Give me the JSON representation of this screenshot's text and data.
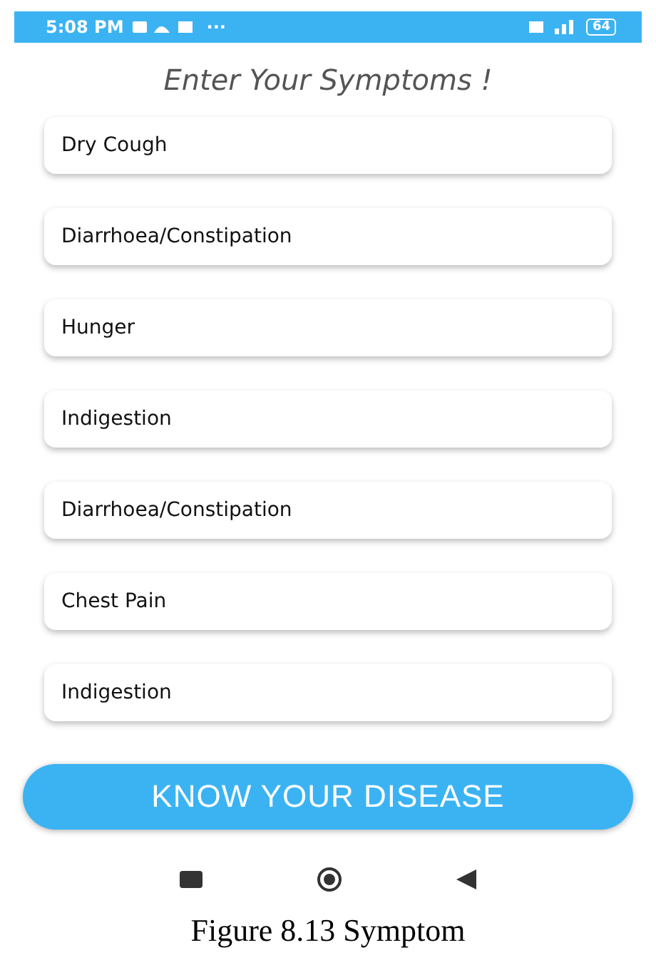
{
  "status_bar": {
    "time": "5:08 PM",
    "more": "···",
    "battery": "64"
  },
  "title": "Enter Your Symptoms !",
  "symptoms": [
    {
      "value": "Dry Cough"
    },
    {
      "value": "Diarrhoea/Constipation"
    },
    {
      "value": "Hunger"
    },
    {
      "value": "Indigestion"
    },
    {
      "value": "Diarrhoea/Constipation"
    },
    {
      "value": "Chest Pain"
    },
    {
      "value": "Indigestion"
    }
  ],
  "submit_button": "KNOW YOUR DISEASE",
  "caption": "Figure 8.13 Symptom"
}
